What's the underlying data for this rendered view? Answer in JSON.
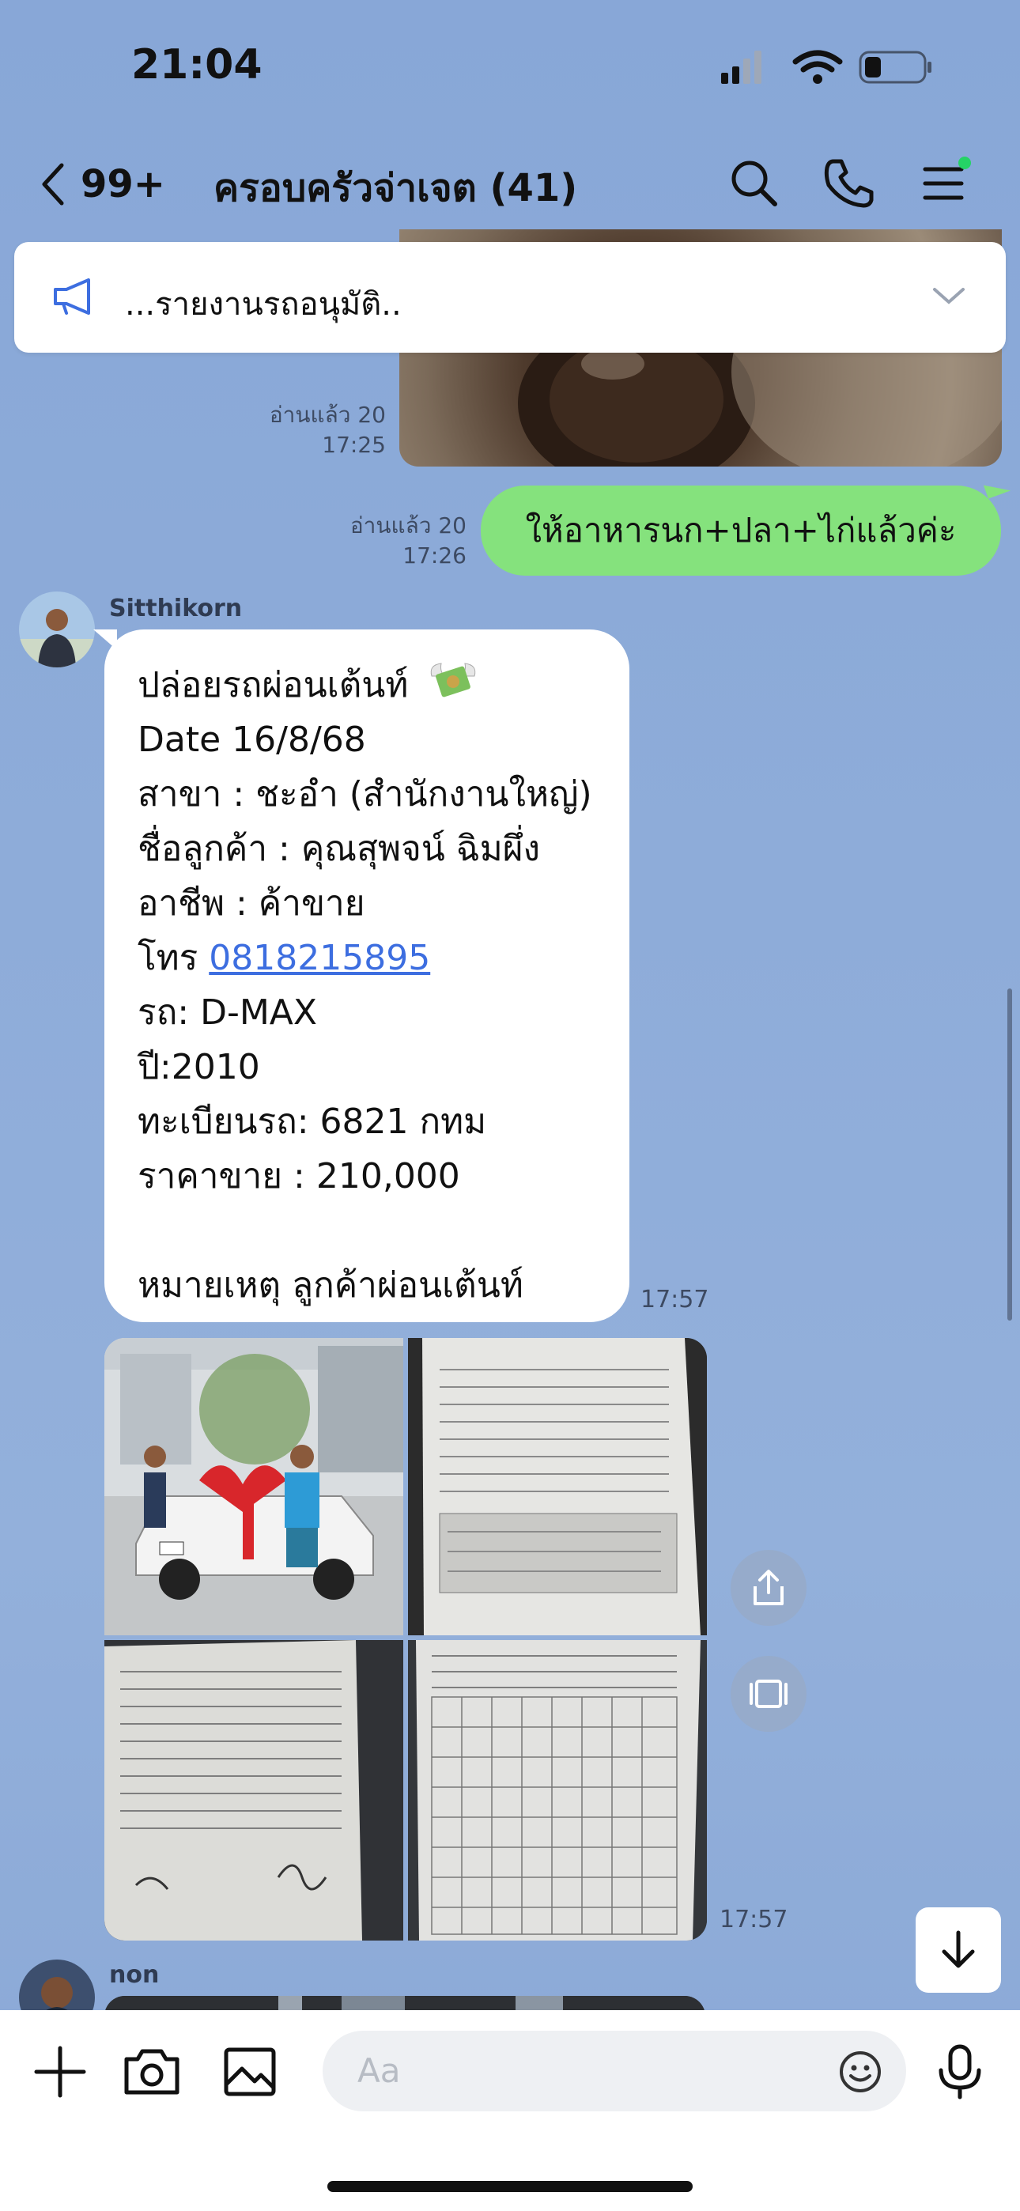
{
  "status_bar": {
    "time": "21:04"
  },
  "header": {
    "back_count": "99+",
    "title": "ครอบครัวจ่าเจต (41)",
    "online_dot_color": "#25d366"
  },
  "announcement": {
    "text": "...รายงานรถอนุมัติ.."
  },
  "messages": {
    "video_read": {
      "read": "อ่านแล้ว 20",
      "time": "17:25"
    },
    "outgoing": {
      "read": "อ่านแล้ว 20",
      "time": "17:26",
      "text": "ให้อาหารนก+ปลา+ไก่แล้วค่ะ"
    },
    "incoming": {
      "sender": "Sitthikorn",
      "time": "17:57",
      "lines": [
        "ปล่อยรถผ่อนเต้นท์",
        "Date 16/8/68",
        "สาขา : ชะอำ (สำนักงานใหญ่)",
        "ชื่อลูกค้า : คุณสุพจน์  ฉิมผึ่ง",
        "อาชีพ :  ค้าขาย",
        "โทร ",
        "รถ: D-MAX",
        "ปี:2010",
        "ทะเบียนรถ:  6821 กทม",
        "ราคาขาย : 210,000",
        "",
        "หมายเหตุ  ลูกค้าผ่อนเต้นท์"
      ],
      "phone": "0818215895"
    },
    "photos": {
      "time": "17:57",
      "count": 4
    },
    "next_sender": "non"
  },
  "input": {
    "placeholder": "Aa"
  }
}
